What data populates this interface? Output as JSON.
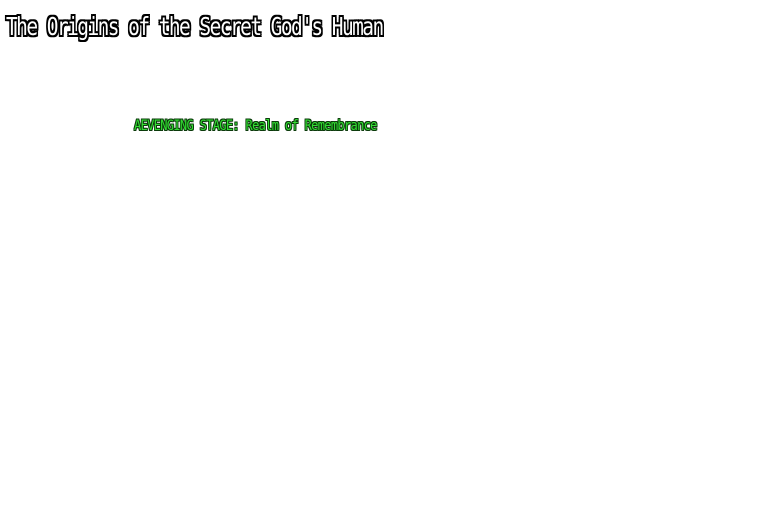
{
  "game": {
    "title": "The Origins of the Secret God's Human"
  },
  "stage": {
    "label": "AEVENGING STAGE: Realm of Remembrance",
    "color": "#33dd33"
  },
  "colors": {
    "background": "#ffffff",
    "title_text": "#ffffff",
    "title_outline": "#000000"
  }
}
